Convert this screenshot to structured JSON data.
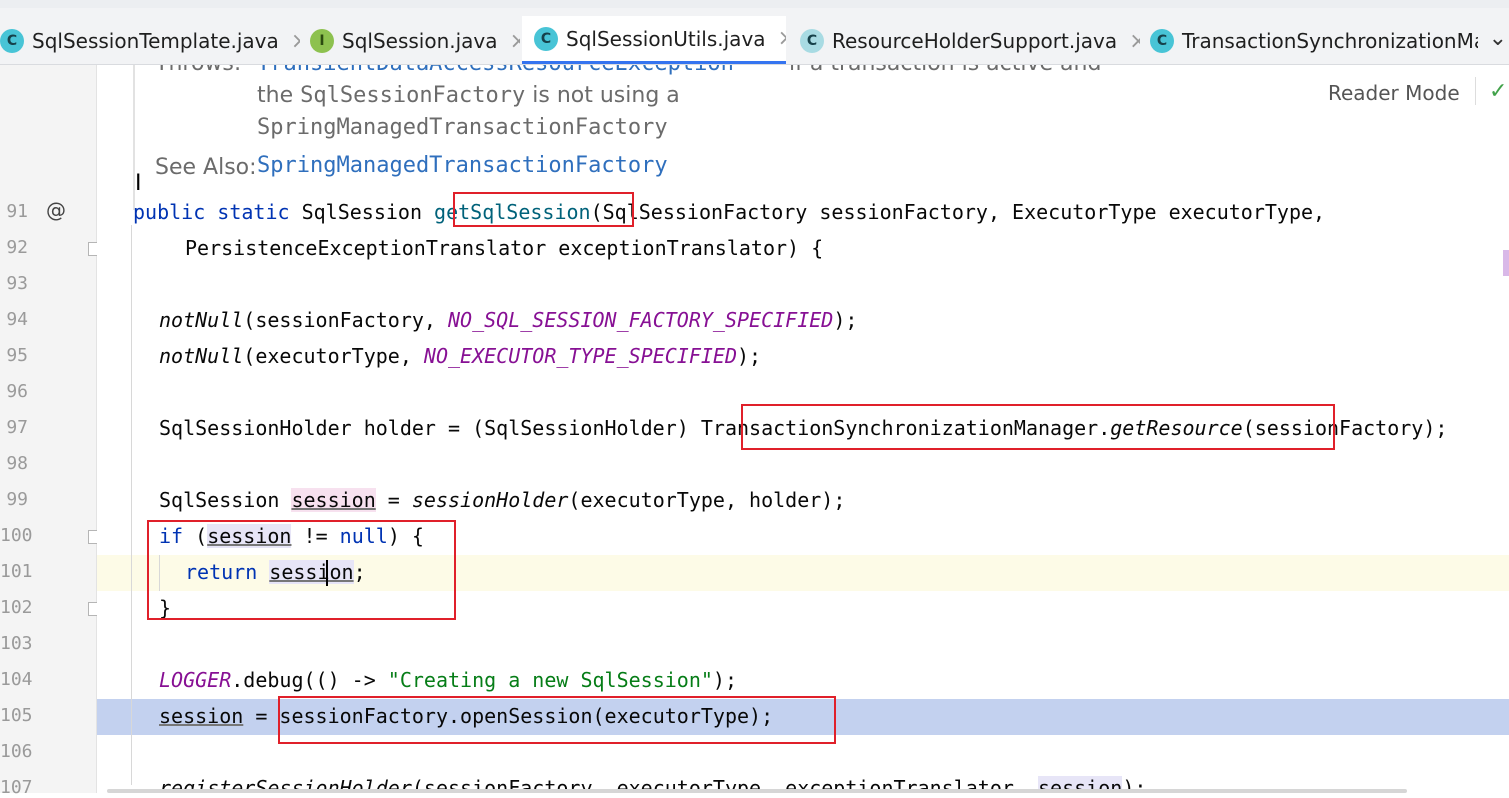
{
  "tabs": [
    {
      "label": "SqlSessionTemplate.java",
      "icon": "class-icon",
      "letter": "C",
      "active": false
    },
    {
      "label": "SqlSession.java",
      "icon": "interface-icon",
      "letter": "I",
      "active": false
    },
    {
      "label": "SqlSessionUtils.java",
      "icon": "class-icon",
      "letter": "C",
      "active": true
    },
    {
      "label": "ResourceHolderSupport.java",
      "icon": "abstract-class-icon",
      "letter": "C",
      "active": false
    },
    {
      "label": "TransactionSynchronizationMan",
      "icon": "class-icon",
      "letter": "C",
      "active": false
    }
  ],
  "tab_close_glyph": "×",
  "tab_more_glyph": "⌄",
  "doc": {
    "throws_label": "Throws:",
    "throws_link": "TransientDataAccessResourceException",
    "throws_text": "– if a transaction is active and",
    "line2_prefix": "the ",
    "line2_mono": "SqlSessionFactory",
    "line2_suffix": " is not using a",
    "line3": "SpringManagedTransactionFactory",
    "see_also_label": "See Also:",
    "see_also_link": "SpringManagedTransactionFactory",
    "reader_mode": "Reader Mode"
  },
  "gutter": {
    "lines": [
      "91",
      "92",
      "93",
      "94",
      "95",
      "96",
      "97",
      "98",
      "99",
      "100",
      "101",
      "102",
      "103",
      "104",
      "105",
      "106",
      "107"
    ],
    "override_marker": "@"
  },
  "code": {
    "l91_kw": "public static",
    "l91_type": " SqlSession ",
    "l91_fn": "getSqlSession",
    "l91_rest": "(SqlSessionFactory sessionFactory, ExecutorType executorType,",
    "l92": "PersistenceExceptionTranslator exceptionTranslator) {",
    "l94_fn": "notNull",
    "l94_a": "(sessionFactory, ",
    "l94_const": "NO_SQL_SESSION_FACTORY_SPECIFIED",
    "l94_end": ");",
    "l95_fn": "notNull",
    "l95_a": "(executorType, ",
    "l95_const": "NO_EXECUTOR_TYPE_SPECIFIED",
    "l95_end": ");",
    "l97_a": "SqlSessionHolder holder = (SqlSessionHolder) ",
    "l97_cls": "TransactionSynchronizationManager.",
    "l97_fn": "getResource",
    "l97_rest": "(sessionFactory);",
    "l99_a": "SqlSession ",
    "l99_var": "session",
    "l99_b": " = ",
    "l99_fn": "sessionHolder",
    "l99_rest": "(executorType, holder);",
    "l100_kw": "if",
    "l100_a": " (",
    "l100_var": "session",
    "l100_b": " != ",
    "l100_null": "null",
    "l100_c": ") {",
    "l101_kw": "return",
    "l101_sp": " ",
    "l101_var": "session",
    "l101_end": ";",
    "l102": "}",
    "l104_const": "LOGGER",
    "l104_a": ".debug(() -> ",
    "l104_str": "\"Creating a new SqlSession\"",
    "l104_end": ");",
    "l105_var": "session",
    "l105_a": " = ",
    "l105_b": "sessionFactory.openSession(executorType);",
    "l107_fn": "registerSessionHolder",
    "l107_a": "(sessionFactory, executorType, exceptionTranslator, ",
    "l107_var": "session",
    "l107_end": ");"
  },
  "colors": {
    "keyword": "#0033b3",
    "constant": "#871094",
    "string": "#067d17",
    "doc_link": "#2f6fbd",
    "annotation_box": "#e0202a",
    "selection": "#c3d1ef"
  }
}
